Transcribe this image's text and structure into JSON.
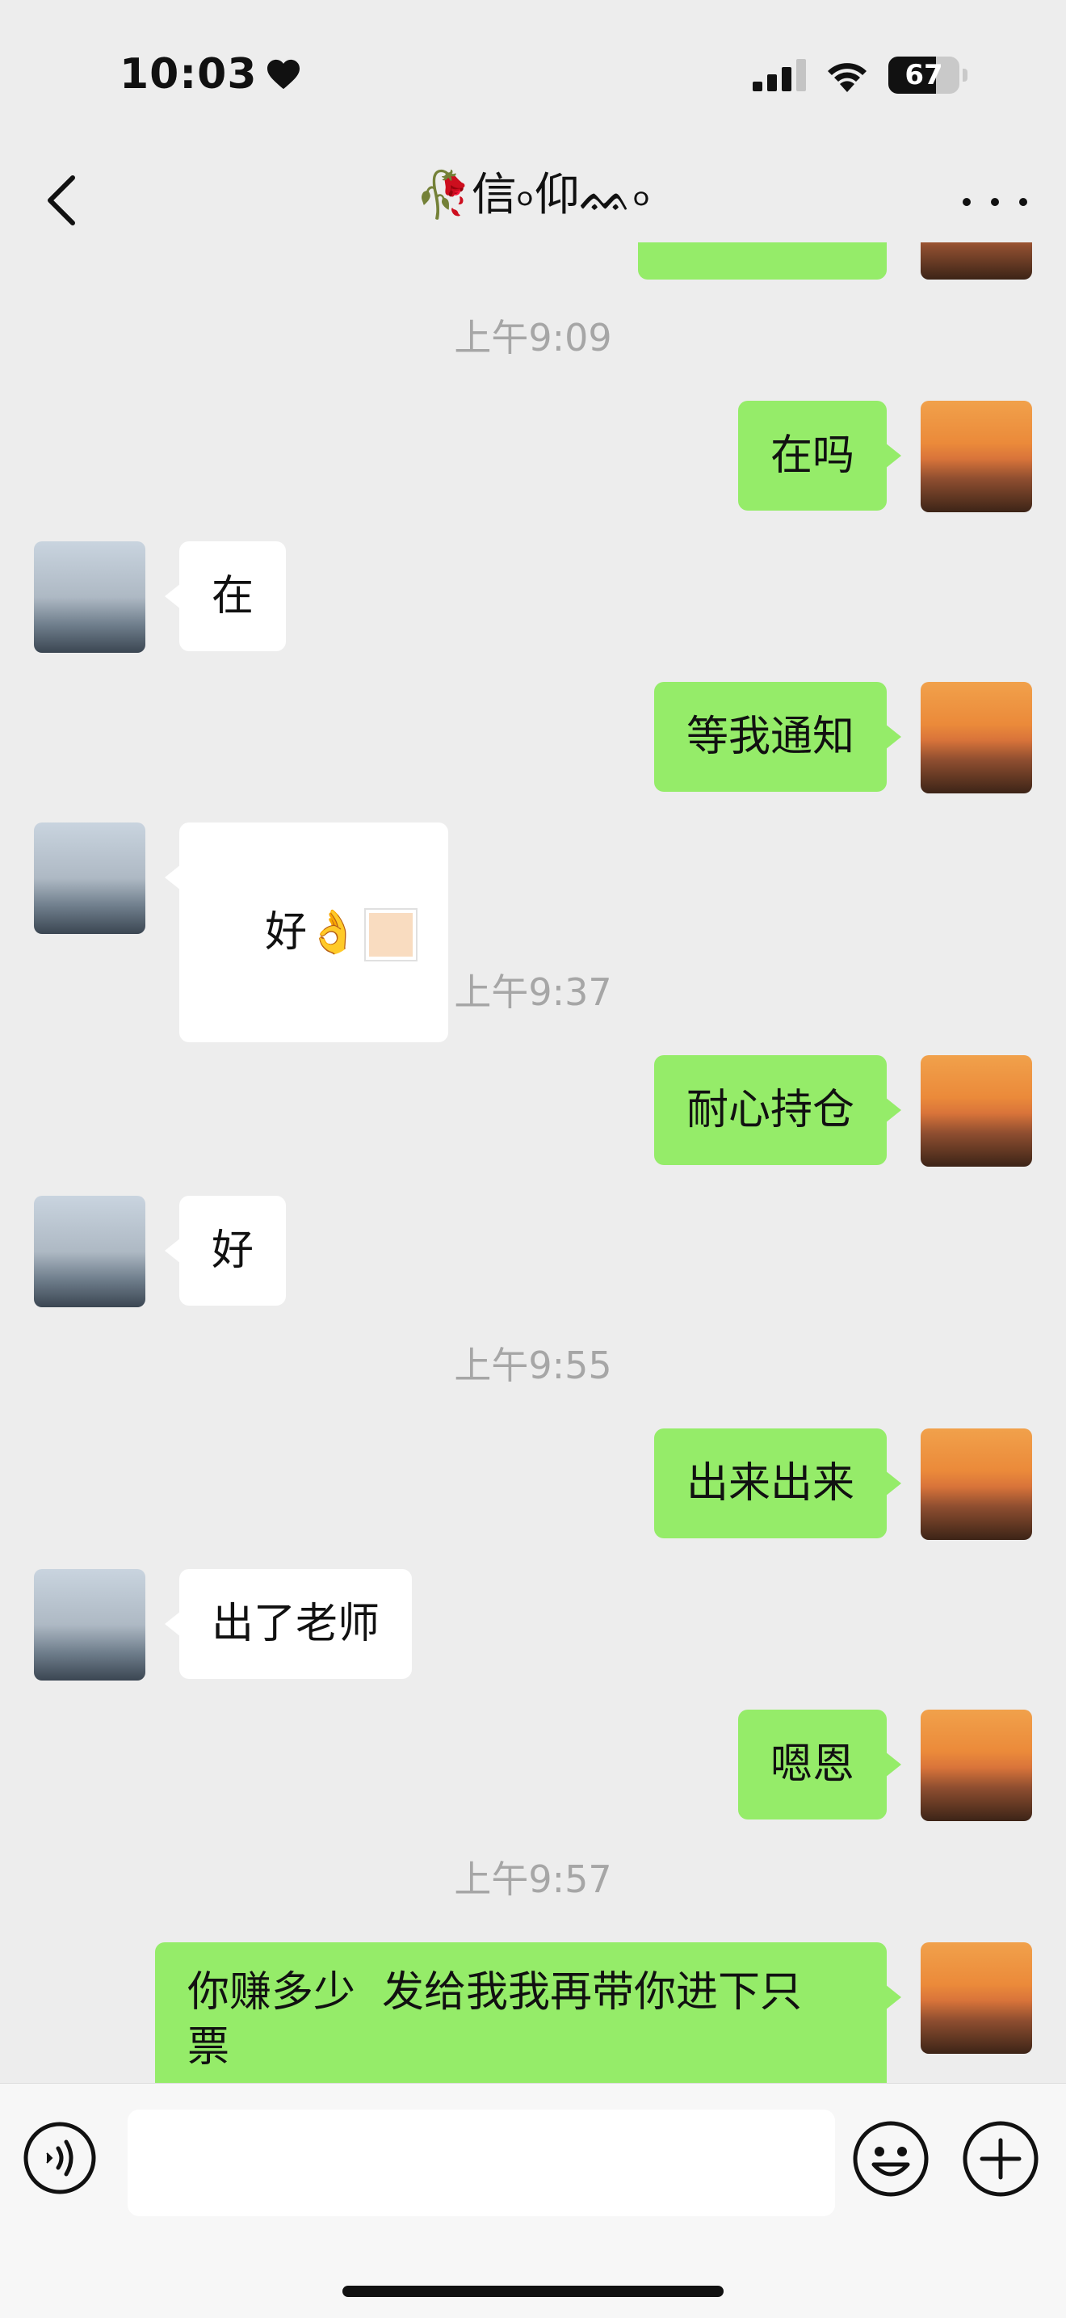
{
  "status_bar": {
    "time": "10:03",
    "battery_level": "67",
    "battery_fraction": 0.67
  },
  "header": {
    "title": "🥀信৹仰ᨐ৹",
    "back_icon": "chevron-left-icon",
    "more_icon": "more-dots-icon"
  },
  "messages": [
    {
      "type": "time",
      "text": "上午9:09"
    },
    {
      "type": "sent",
      "text": "在吗"
    },
    {
      "type": "received",
      "text": "在"
    },
    {
      "type": "sent",
      "text": "等我通知"
    },
    {
      "type": "received",
      "text": "好👌"
    },
    {
      "type": "time",
      "text": "上午9:37"
    },
    {
      "type": "sent",
      "text": "耐心持仓"
    },
    {
      "type": "received",
      "text": "好"
    },
    {
      "type": "time",
      "text": "上午9:55"
    },
    {
      "type": "sent",
      "text": "出来出来"
    },
    {
      "type": "received",
      "text": "出了老师"
    },
    {
      "type": "sent",
      "text": "嗯恩"
    },
    {
      "type": "time",
      "text": "上午9:57"
    },
    {
      "type": "sent",
      "text": "你赚多少  发给我我再带你进下只\n票"
    }
  ],
  "input_bar": {
    "value": "",
    "voice_icon": "voice-icon",
    "emoji_icon": "emoji-icon",
    "plus_icon": "plus-circle-icon"
  },
  "colors": {
    "sent_bubble": "#95ec69",
    "received_bubble": "#ffffff",
    "background": "#ededed",
    "timestamp": "#a6a6a6"
  }
}
